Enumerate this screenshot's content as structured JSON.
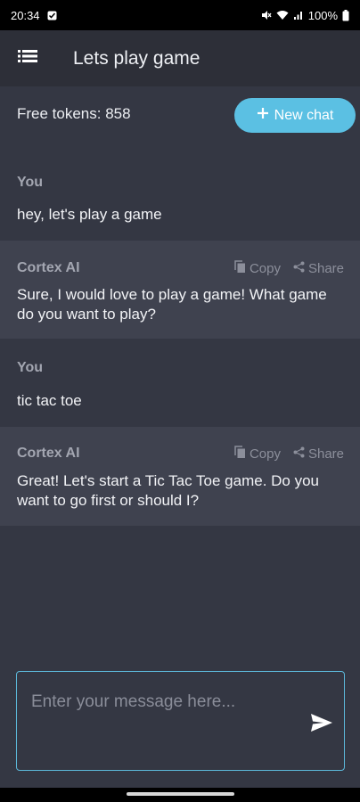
{
  "status_bar": {
    "time": "20:34",
    "battery": "100%",
    "icons": [
      "notification-icon",
      "mute-icon",
      "wifi-icon",
      "signal-icon",
      "battery-icon"
    ]
  },
  "app_bar": {
    "title": "Lets play game",
    "menu_icon": "menu-icon"
  },
  "tokens": {
    "label": "Free tokens: 858"
  },
  "new_chat": {
    "label": "New chat",
    "icon": "plus-icon"
  },
  "messages": [
    {
      "author": "You",
      "text": "hey, let's play a game",
      "role": "user"
    },
    {
      "author": "Cortex AI",
      "text": "Sure, I would love to play a game! What game do you want to play?",
      "role": "ai",
      "copy_label": "Copy",
      "share_label": "Share"
    },
    {
      "author": "You",
      "text": "tic tac toe",
      "role": "user"
    },
    {
      "author": "Cortex AI",
      "text": "Great! Let's start a Tic Tac Toe game. Do you want to go first or should I?",
      "role": "ai",
      "copy_label": "Copy",
      "share_label": "Share"
    }
  ],
  "composer": {
    "placeholder": "Enter your message here...",
    "value": "",
    "send_icon": "send-icon"
  },
  "colors": {
    "accent": "#5bc0e3",
    "background": "#343743",
    "ai_message_bg": "#3f424f",
    "app_bar": "#2d2f38"
  }
}
